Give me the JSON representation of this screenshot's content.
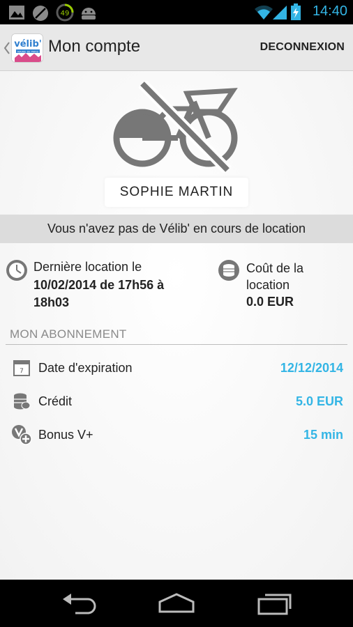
{
  "status_bar": {
    "time": "14:40",
    "notification_badge": "49",
    "icons": [
      "image-icon",
      "blocked-icon",
      "battery-49-icon",
      "android-icon",
      "wifi-icon",
      "signal-icon",
      "battery-charging-icon"
    ]
  },
  "action_bar": {
    "title": "Mon compte",
    "logout_label": "DECONNEXION",
    "logo_text": "vélib'",
    "logo_sub": "MAIRIE DE PARIS"
  },
  "profile": {
    "name": "SOPHIE MARTIN"
  },
  "rental_status": "Vous n'avez pas de Vélib' en cours de location",
  "last_rental": {
    "label": "Dernière location le",
    "value": "10/02/2014 de 17h56 à 18h03"
  },
  "rental_cost": {
    "label": "Coût de la location",
    "value": "0.0 EUR"
  },
  "subscription": {
    "header": "MON ABONNEMENT",
    "rows": [
      {
        "label": "Date d'expiration",
        "value": "12/12/2014",
        "icon": "calendar-icon"
      },
      {
        "label": "Crédit",
        "value": "5.0 EUR",
        "icon": "coins-icon"
      },
      {
        "label": "Bonus V+",
        "value": "15 min",
        "icon": "v-plus-icon"
      }
    ]
  },
  "colors": {
    "accent": "#33b5e5",
    "action_bar": "#e8e8e8",
    "banner": "#dcdcdc",
    "icon_gray": "#777777"
  }
}
